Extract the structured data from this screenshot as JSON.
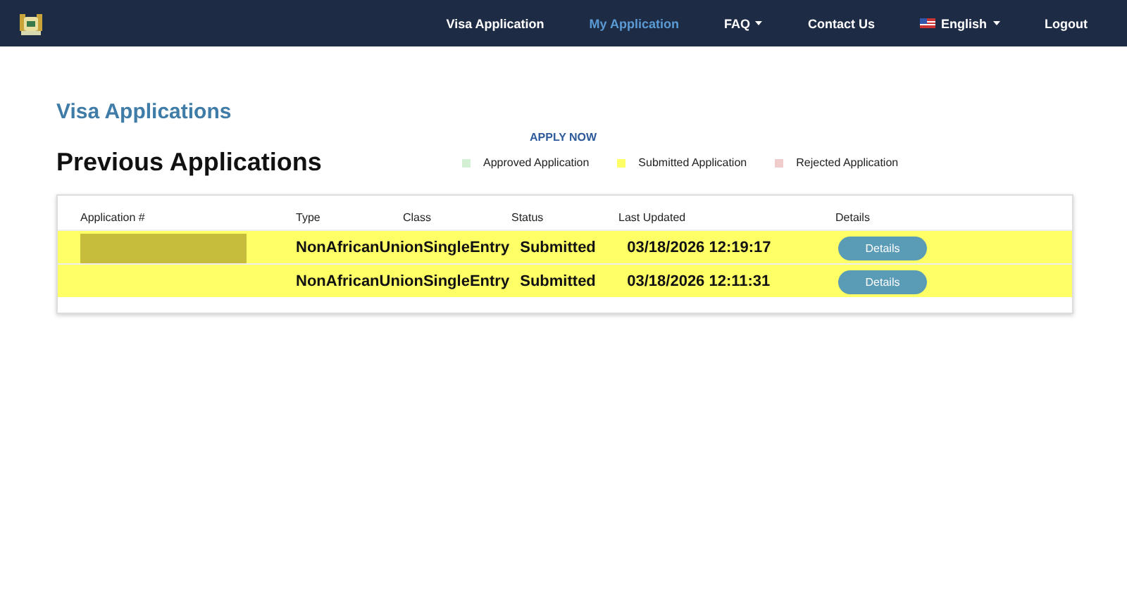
{
  "nav": {
    "items": [
      {
        "label": "Visa Application",
        "selected": false,
        "dropdown": false
      },
      {
        "label": "My Application",
        "selected": true,
        "dropdown": false
      },
      {
        "label": "FAQ",
        "selected": false,
        "dropdown": true
      },
      {
        "label": "Contact Us",
        "selected": false,
        "dropdown": false
      },
      {
        "label": "English",
        "selected": false,
        "dropdown": true,
        "flag": true
      },
      {
        "label": "Logout",
        "selected": false,
        "dropdown": false
      }
    ]
  },
  "section_title": "Visa Applications",
  "apply_link": "APPLY NOW",
  "heading": "Previous Applications",
  "legend": [
    {
      "label": "Approved Application",
      "color": "#d4f0d4"
    },
    {
      "label": "Submitted Application",
      "color": "#ffff66"
    },
    {
      "label": "Rejected Application",
      "color": "#f0cccc"
    }
  ],
  "table": {
    "columns": [
      "Application #",
      "Type",
      "Class",
      "Status",
      "Last Updated",
      "Details"
    ],
    "rows": [
      {
        "type": "NonAfricanUnionSingleEntry",
        "status": "Submitted",
        "updated": "03/18/2026 12:19:17",
        "button": "Details",
        "color": "#ffff66"
      },
      {
        "type": "NonAfricanUnionSingleEntry",
        "status": "Submitted",
        "updated": "03/18/2026 12:11:31",
        "button": "Details",
        "color": "#ffff66"
      }
    ]
  }
}
